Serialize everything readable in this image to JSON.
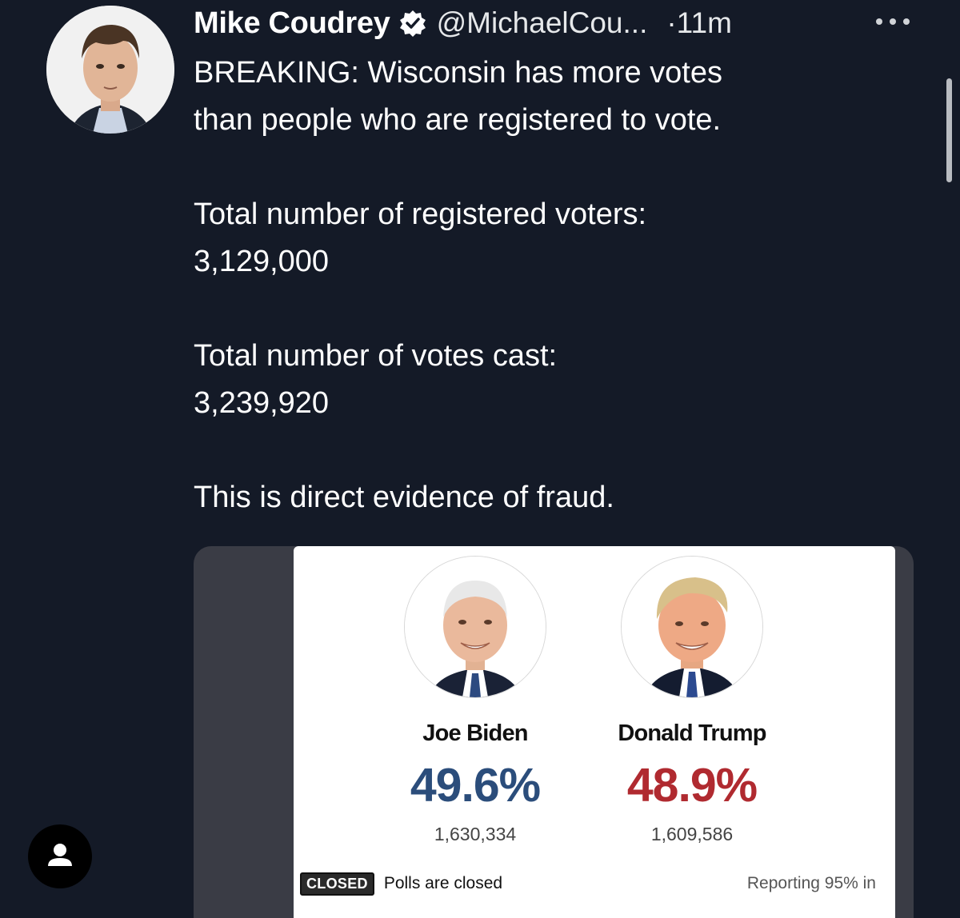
{
  "tweet": {
    "author_name": "Mike Coudrey",
    "handle": "@MichaelCou...",
    "time": "·11m",
    "lines": {
      "headline_1": "BREAKING: Wisconsin has more votes",
      "headline_2": "than people who are registered to vote.",
      "registered_label": "Total number of registered voters:",
      "registered_value": "3,129,000",
      "cast_label": "Total number of votes cast:",
      "cast_value": "3,239,920",
      "conclusion": "This is direct evidence of fraud."
    }
  },
  "media": {
    "candidates": [
      {
        "name": "Joe Biden",
        "percent": "49.6%",
        "votes": "1,630,334",
        "color": "#2b4d7b"
      },
      {
        "name": "Donald Trump",
        "percent": "48.9%",
        "votes": "1,609,586",
        "color": "#b02a30"
      }
    ],
    "closed_badge": "CLOSED",
    "polls_status": "Polls are closed",
    "reporting": "Reporting 95% in"
  },
  "icons": {
    "verified": "verified-badge-icon",
    "more": "more-horizontal-icon",
    "profile": "person-icon"
  },
  "colors": {
    "background": "#141a27",
    "biden_blue": "#2b4d7b",
    "trump_red": "#b02a30"
  }
}
